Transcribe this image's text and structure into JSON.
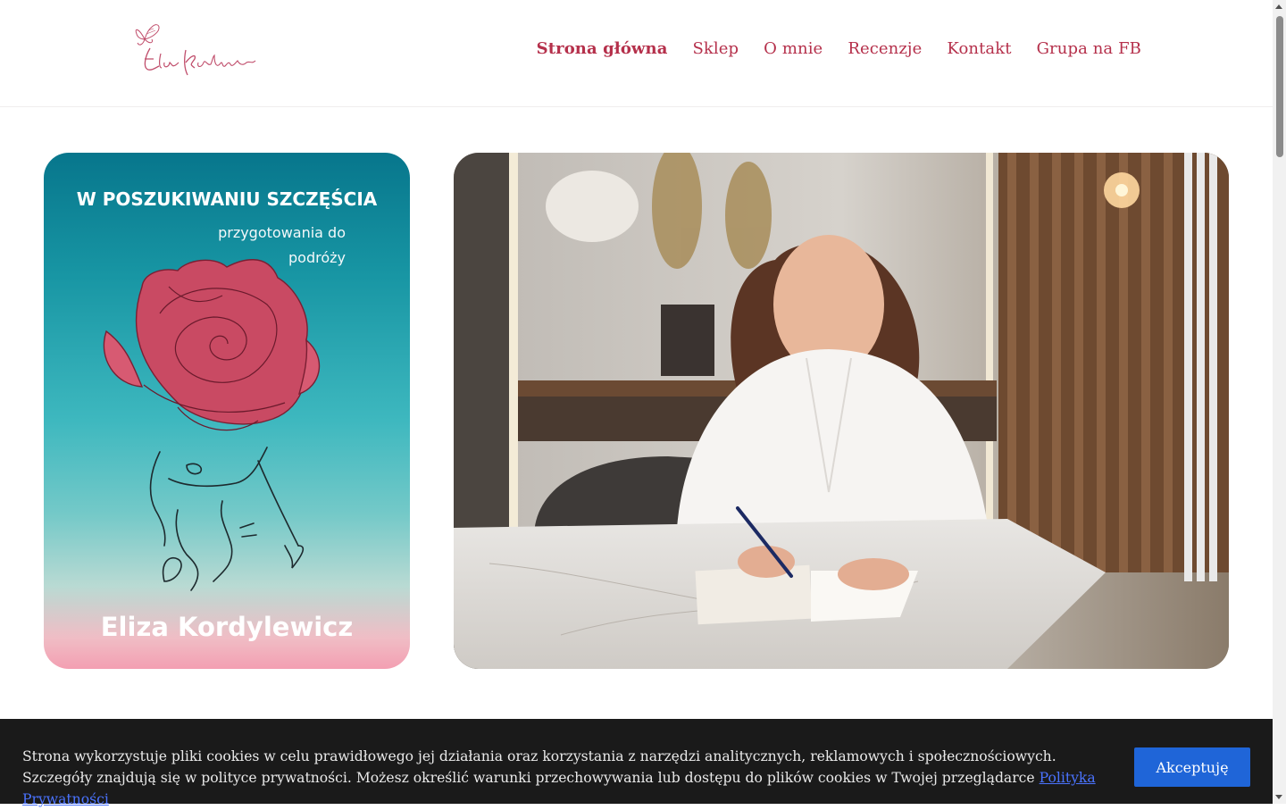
{
  "header": {
    "logo_text": "Eliza Kordylewicz",
    "nav": [
      {
        "label": "Strona główna",
        "active": true
      },
      {
        "label": "Sklep"
      },
      {
        "label": "O mnie"
      },
      {
        "label": "Recenzje"
      },
      {
        "label": "Kontakt"
      },
      {
        "label": "Grupa na FB"
      }
    ]
  },
  "book": {
    "title": "W POSZUKIWANIU SZCZĘŚCIA",
    "subtitle_line1": "przygotowania do",
    "subtitle_line2": "podróży",
    "author": "Eliza Kordylewicz"
  },
  "cookie": {
    "text": "Strona wykorzystuje pliki cookies w celu prawidłowego jej działania oraz korzystania z narzędzi analitycznych, reklamowych i społecznościowych. Szczegóły znajdują się w polityce prywatności. Możesz określić warunki przechowywania lub dostępu do plików cookies w Twojej przeglądarce",
    "link": "Polityka Prywatności",
    "accept": "Akceptuję"
  },
  "colors": {
    "accent": "#b5304b",
    "cookie_bg": "#1a1a1a",
    "button": "#1f65d8"
  }
}
